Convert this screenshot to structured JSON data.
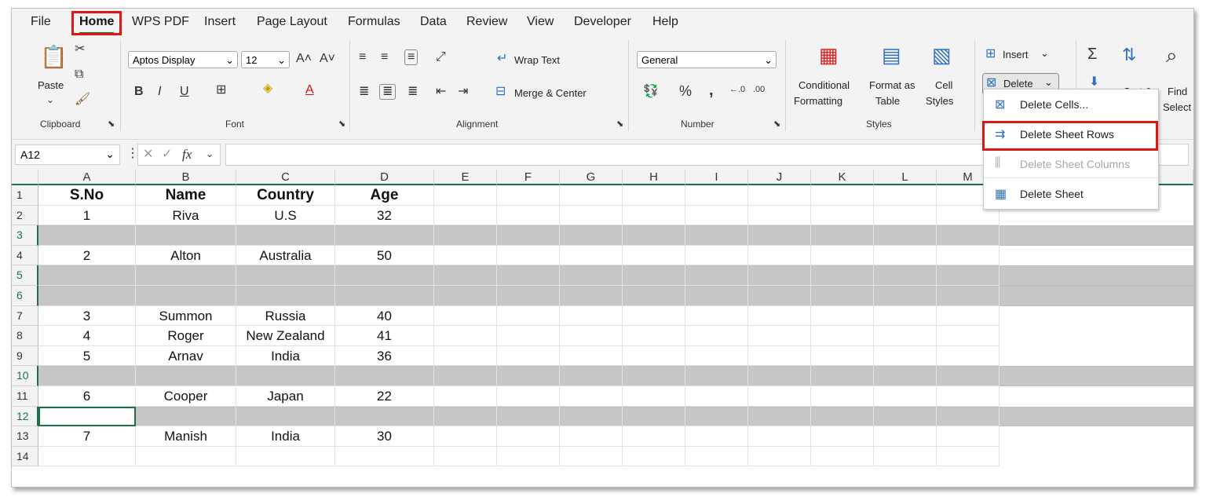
{
  "tabs": [
    "File",
    "Home",
    "WPS PDF",
    "Insert",
    "Page Layout",
    "Formulas",
    "Data",
    "Review",
    "View",
    "Developer",
    "Help"
  ],
  "ribbon": {
    "clipboard": {
      "paste": "Paste",
      "label": "Clipboard"
    },
    "font": {
      "name": "Aptos Display",
      "size": "12",
      "label": "Font",
      "bold": "B",
      "italic": "I",
      "underline": "U"
    },
    "alignment": {
      "wrap": "Wrap Text",
      "merge": "Merge & Center",
      "label": "Alignment"
    },
    "number": {
      "format": "General",
      "label": "Number"
    },
    "styles": {
      "conditional_1": "Conditional",
      "conditional_2": "Formatting",
      "format_as_1": "Format as",
      "format_as_2": "Table",
      "cell_1": "Cell",
      "cell_2": "Styles",
      "label": "Styles"
    },
    "cells": {
      "insert": "Insert",
      "delete": "Delete"
    },
    "editing": {
      "sort": "Sort &",
      "find": "Find",
      "select": "Select"
    }
  },
  "formula_bar": {
    "name_box": "A12",
    "fx": "fx"
  },
  "columns": [
    "A",
    "B",
    "C",
    "D",
    "E",
    "F",
    "G",
    "H",
    "I",
    "J",
    "K",
    "L",
    "M"
  ],
  "rows": [
    {
      "num": "1",
      "cells": [
        "S.No",
        "Name",
        "Country",
        "Age"
      ],
      "bold": true
    },
    {
      "num": "2",
      "cells": [
        "1",
        "Riva",
        "U.S",
        "32"
      ]
    },
    {
      "num": "3",
      "cells": [
        "",
        "",
        "",
        ""
      ],
      "gray": true
    },
    {
      "num": "4",
      "cells": [
        "2",
        "Alton",
        "Australia",
        "50"
      ]
    },
    {
      "num": "5",
      "cells": [
        "",
        "",
        "",
        ""
      ],
      "gray": true
    },
    {
      "num": "6",
      "cells": [
        "",
        "",
        "",
        ""
      ],
      "gray": true
    },
    {
      "num": "7",
      "cells": [
        "3",
        "Summon",
        "Russia",
        "40"
      ]
    },
    {
      "num": "8",
      "cells": [
        "4",
        "Roger",
        "New Zealand",
        "41"
      ]
    },
    {
      "num": "9",
      "cells": [
        "5",
        "Arnav",
        "India",
        "36"
      ]
    },
    {
      "num": "10",
      "cells": [
        "",
        "",
        "",
        ""
      ],
      "gray": true
    },
    {
      "num": "11",
      "cells": [
        "6",
        "Cooper",
        "Japan",
        "22"
      ]
    },
    {
      "num": "12",
      "cells": [
        "",
        "",
        "",
        ""
      ],
      "gray": true
    },
    {
      "num": "13",
      "cells": [
        "7",
        "Manish",
        "India",
        "30"
      ]
    },
    {
      "num": "14",
      "cells": [
        "",
        "",
        "",
        ""
      ]
    }
  ],
  "delete_menu": {
    "items": [
      "Delete Cells...",
      "Delete Sheet Rows",
      "Delete Sheet Columns",
      "Delete Sheet"
    ]
  },
  "colors": {
    "accent": "#1e7145",
    "highlight": "#e01616",
    "deleted_row": "#c6c6c6"
  }
}
